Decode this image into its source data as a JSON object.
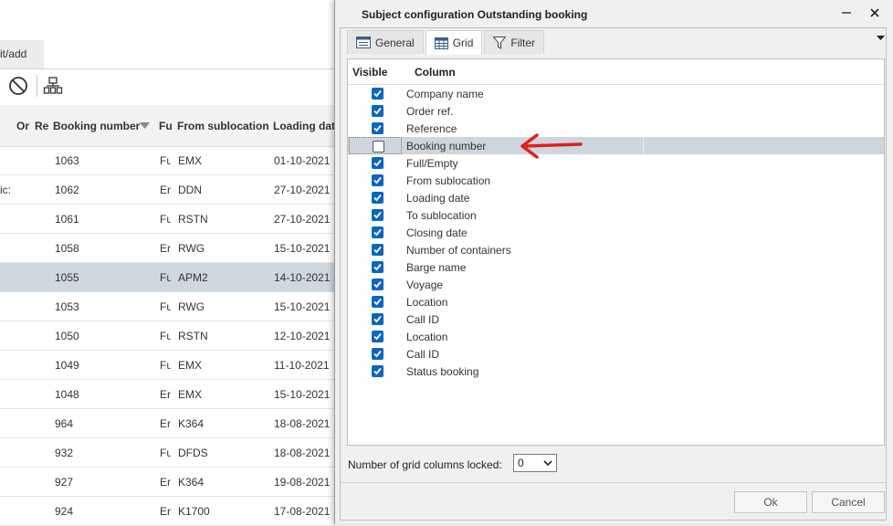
{
  "background_app": {
    "tab_label": "it/add",
    "headers": [
      "Or",
      "Re",
      "Booking number",
      "Fu",
      "From sublocation",
      "Loading dat"
    ],
    "rows": [
      {
        "pre": "",
        "booking": "1063",
        "fu": "Fu",
        "from": "EMX",
        "date": "01-10-2021",
        "selected": false
      },
      {
        "pre": "ic:",
        "booking": "1062",
        "fu": "Er",
        "from": "DDN",
        "date": "27-10-2021",
        "selected": false
      },
      {
        "pre": "",
        "booking": "1061",
        "fu": "Fu",
        "from": "RSTN",
        "date": "27-10-2021",
        "selected": false
      },
      {
        "pre": "",
        "booking": "1058",
        "fu": "Er",
        "from": "RWG",
        "date": "15-10-2021",
        "selected": false
      },
      {
        "pre": "",
        "booking": "1055",
        "fu": "Fu",
        "from": "APM2",
        "date": "14-10-2021",
        "selected": true
      },
      {
        "pre": "",
        "booking": "1053",
        "fu": "Fu",
        "from": "RWG",
        "date": "15-10-2021",
        "selected": false
      },
      {
        "pre": "",
        "booking": "1050",
        "fu": "Fu",
        "from": "RSTN",
        "date": "12-10-2021",
        "selected": false
      },
      {
        "pre": "",
        "booking": "1049",
        "fu": "Fu",
        "from": "EMX",
        "date": "11-10-2021",
        "selected": false
      },
      {
        "pre": "",
        "booking": "1048",
        "fu": "Er",
        "from": "EMX",
        "date": "15-10-2021",
        "selected": false
      },
      {
        "pre": "",
        "booking": "964",
        "fu": "Er",
        "from": "K364",
        "date": "18-08-2021",
        "selected": false
      },
      {
        "pre": "",
        "booking": "932",
        "fu": "Fu",
        "from": "DFDS",
        "date": "18-08-2021",
        "selected": false
      },
      {
        "pre": "",
        "booking": "927",
        "fu": "Er",
        "from": "K364",
        "date": "19-08-2021",
        "selected": false
      },
      {
        "pre": "",
        "booking": "924",
        "fu": "Er",
        "from": "K1700",
        "date": "17-08-2021",
        "selected": false
      }
    ]
  },
  "dialog": {
    "title": "Subject configuration Outstanding booking",
    "tabs": [
      {
        "label": "General",
        "icon": "form-icon",
        "active": false
      },
      {
        "label": "Grid",
        "icon": "grid-icon",
        "active": true
      },
      {
        "label": "Filter",
        "icon": "filter-icon",
        "active": false
      }
    ],
    "grid_header": {
      "visible": "Visible",
      "column": "Column"
    },
    "columns": [
      {
        "label": "Company name",
        "visible": true
      },
      {
        "label": "Order ref.",
        "visible": true
      },
      {
        "label": "Reference",
        "visible": true
      },
      {
        "label": "Booking number",
        "visible": false,
        "highlighted": true
      },
      {
        "label": "Full/Empty",
        "visible": true
      },
      {
        "label": "From sublocation",
        "visible": true
      },
      {
        "label": "Loading date",
        "visible": true
      },
      {
        "label": "To sublocation",
        "visible": true
      },
      {
        "label": "Closing date",
        "visible": true
      },
      {
        "label": "Number of containers",
        "visible": true
      },
      {
        "label": "Barge name",
        "visible": true
      },
      {
        "label": "Voyage",
        "visible": true
      },
      {
        "label": "Location",
        "visible": true
      },
      {
        "label": "Call ID",
        "visible": true
      },
      {
        "label": "Location",
        "visible": true
      },
      {
        "label": "Call ID",
        "visible": true
      },
      {
        "label": "Status booking",
        "visible": true
      }
    ],
    "locked_label": "Number of grid columns locked:",
    "locked_value": "0",
    "ok_label": "Ok",
    "cancel_label": "Cancel"
  },
  "colors": {
    "checkbox_checked": "#0a66c2",
    "row_highlight": "#cdd6de",
    "annotation_arrow": "#e0201b"
  }
}
